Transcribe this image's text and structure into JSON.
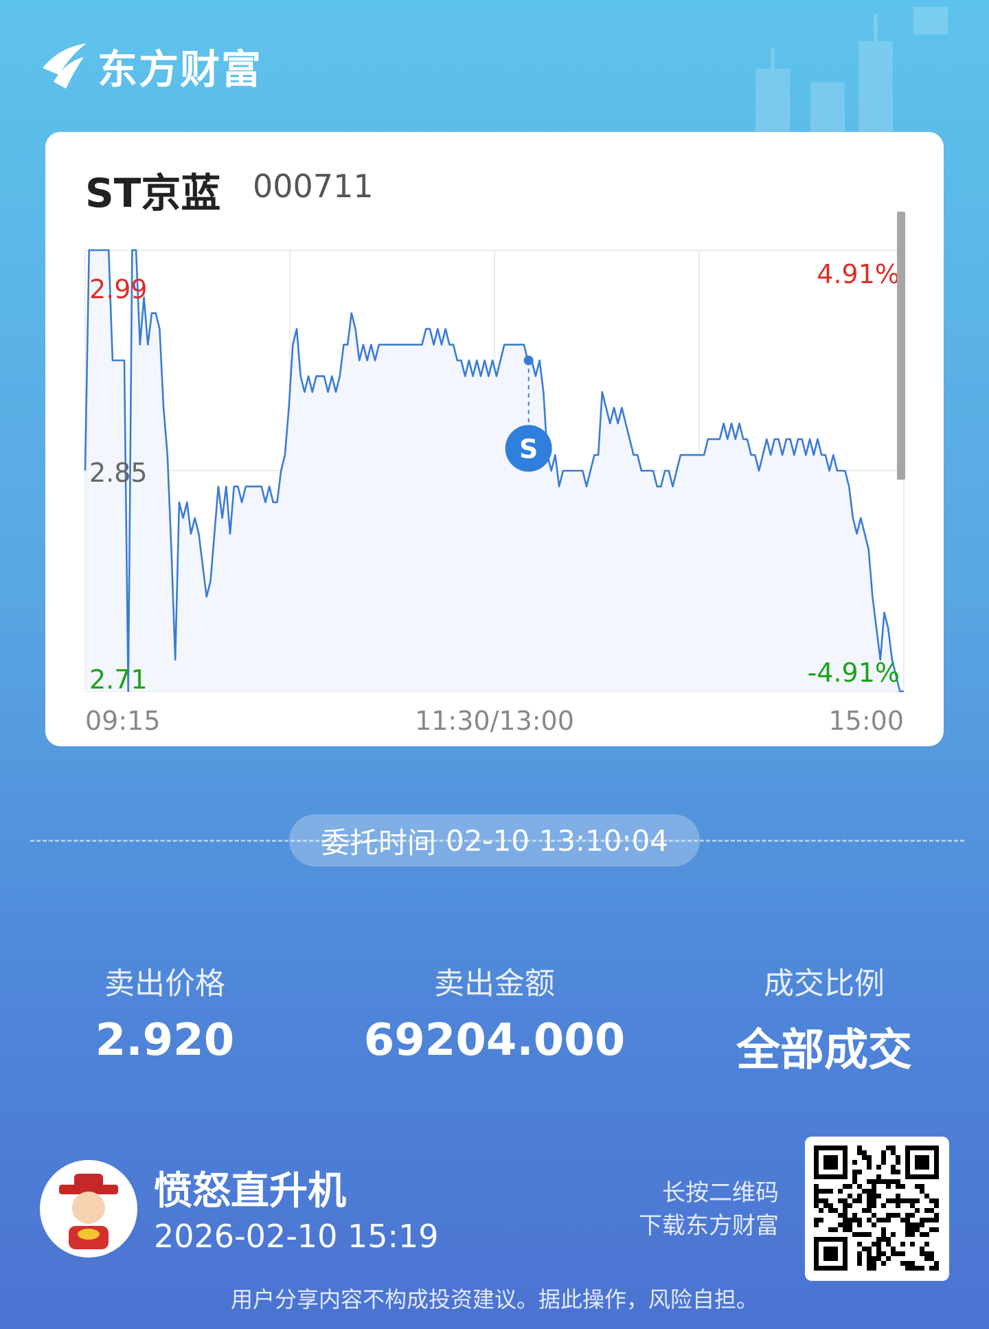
{
  "brand": {
    "name": "东方财富",
    "logo_icon": "eastmoney-logo-icon"
  },
  "stock": {
    "name": "ST京蓝",
    "code": "000711"
  },
  "chart_data": {
    "type": "line",
    "title": "",
    "x_ticks": [
      "09:15",
      "11:30/13:00",
      "15:00"
    ],
    "y_left_ticks": [
      "2.99",
      "2.85",
      "2.71"
    ],
    "y_right_ticks": [
      "4.91%",
      "-4.91%"
    ],
    "ylim": [
      2.71,
      2.99
    ],
    "colors": {
      "line": "#3a7bd5",
      "fill": "#f3f7fd",
      "up": "#d9302a",
      "down": "#1aa31a",
      "grid": "#e6e6e6"
    },
    "series": [
      {
        "values": [
          2.85,
          2.99,
          2.99,
          2.99,
          2.99,
          2.99,
          2.99,
          2.92,
          2.92,
          2.92,
          2.92,
          2.71,
          2.99,
          2.99,
          2.93,
          2.96,
          2.93,
          2.95,
          2.95,
          2.94,
          2.89,
          2.86,
          2.8,
          2.73,
          2.83,
          2.82,
          2.83,
          2.81,
          2.82,
          2.81,
          2.79,
          2.77,
          2.78,
          2.81,
          2.84,
          2.82,
          2.84,
          2.81,
          2.84,
          2.84,
          2.83,
          2.84,
          2.84,
          2.84,
          2.84,
          2.84,
          2.83,
          2.84,
          2.83,
          2.83,
          2.85,
          2.86,
          2.89,
          2.93,
          2.94,
          2.91,
          2.9,
          2.91,
          2.9,
          2.91,
          2.91,
          2.91,
          2.9,
          2.91,
          2.9,
          2.91,
          2.93,
          2.93,
          2.95,
          2.94,
          2.92,
          2.93,
          2.92,
          2.93,
          2.92,
          2.93,
          2.93,
          2.93,
          2.93,
          2.93,
          2.93,
          2.93,
          2.93,
          2.93,
          2.93,
          2.93,
          2.93,
          2.94,
          2.94,
          2.93,
          2.94,
          2.93,
          2.94,
          2.93,
          2.93,
          2.92,
          2.92,
          2.91,
          2.92,
          2.91,
          2.92,
          2.91,
          2.92,
          2.91,
          2.92,
          2.91,
          2.92,
          2.93,
          2.93,
          2.93,
          2.93,
          2.93,
          2.93,
          2.92,
          2.92,
          2.91,
          2.92,
          2.9,
          2.86,
          2.85,
          2.86,
          2.84,
          2.85,
          2.85,
          2.85,
          2.85,
          2.85,
          2.85,
          2.84,
          2.85,
          2.86,
          2.86,
          2.9,
          2.89,
          2.88,
          2.89,
          2.88,
          2.89,
          2.88,
          2.87,
          2.86,
          2.86,
          2.85,
          2.85,
          2.85,
          2.85,
          2.84,
          2.84,
          2.85,
          2.85,
          2.84,
          2.85,
          2.86,
          2.86,
          2.86,
          2.86,
          2.86,
          2.86,
          2.86,
          2.87,
          2.87,
          2.87,
          2.87,
          2.88,
          2.87,
          2.88,
          2.87,
          2.88,
          2.87,
          2.87,
          2.86,
          2.86,
          2.85,
          2.86,
          2.87,
          2.86,
          2.87,
          2.87,
          2.86,
          2.87,
          2.87,
          2.86,
          2.87,
          2.87,
          2.86,
          2.87,
          2.86,
          2.87,
          2.86,
          2.86,
          2.85,
          2.86,
          2.85,
          2.85,
          2.85,
          2.84,
          2.82,
          2.81,
          2.82,
          2.81,
          2.8,
          2.77,
          2.75,
          2.73,
          2.76,
          2.75,
          2.73,
          2.72,
          2.71,
          2.71
        ]
      }
    ],
    "marker": {
      "label": "S",
      "type": "sell",
      "time": "13:10",
      "price": 2.92
    }
  },
  "order": {
    "label": "委托时间",
    "time": "02-10 13:10:04"
  },
  "stats": [
    {
      "label": "卖出价格",
      "value": "2.920"
    },
    {
      "label": "卖出金额",
      "value": "69204.000"
    },
    {
      "label": "成交比例",
      "value": "全部成交"
    }
  ],
  "user": {
    "name": "愤怒直升机",
    "datetime": "2026-02-10 15:19",
    "avatar_icon": "fortune-god-avatar-icon"
  },
  "qr": {
    "tip_line1": "长按二维码",
    "tip_line2": "下载东方财富",
    "icon": "qr-code-icon"
  },
  "disclaimer": "用户分享内容不构成投资建议。据此操作，风险自担。"
}
